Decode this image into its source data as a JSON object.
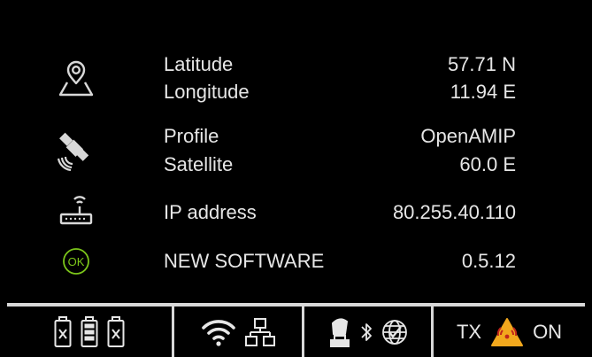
{
  "rows": {
    "location": {
      "icon": "map-pin-icon",
      "latitude_label": "Latitude",
      "latitude_value": "57.71 N",
      "longitude_label": "Longitude",
      "longitude_value": "11.94 E"
    },
    "satellite": {
      "icon": "satellite-icon",
      "profile_label": "Profile",
      "profile_value": "OpenAMIP",
      "satellite_label": "Satellite",
      "satellite_value": "60.0 E"
    },
    "network": {
      "icon": "router-icon",
      "ip_label": "IP address",
      "ip_value": "80.255.40.110"
    },
    "software": {
      "icon": "ok-icon",
      "icon_text": "OK",
      "software_label": "NEW SOFTWARE",
      "software_value": "0.5.12"
    }
  },
  "statusbar": {
    "power": {
      "icons": [
        "battery-error-icon",
        "battery-full-icon",
        "battery-error-icon"
      ]
    },
    "connectivity": {
      "icons": [
        "wifi-icon",
        "network-icon"
      ]
    },
    "antenna": {
      "icons": [
        "antenna-icon",
        "bluetooth-icon",
        "globe-check-icon"
      ]
    },
    "transmit": {
      "prefix": "TX",
      "suffix": "ON",
      "icon": "radiation-warning-icon",
      "warning_color": "#f2a81d"
    }
  },
  "colors": {
    "background": "#000000",
    "text": "#e6e6e6",
    "ok_green": "#7cc61a"
  }
}
